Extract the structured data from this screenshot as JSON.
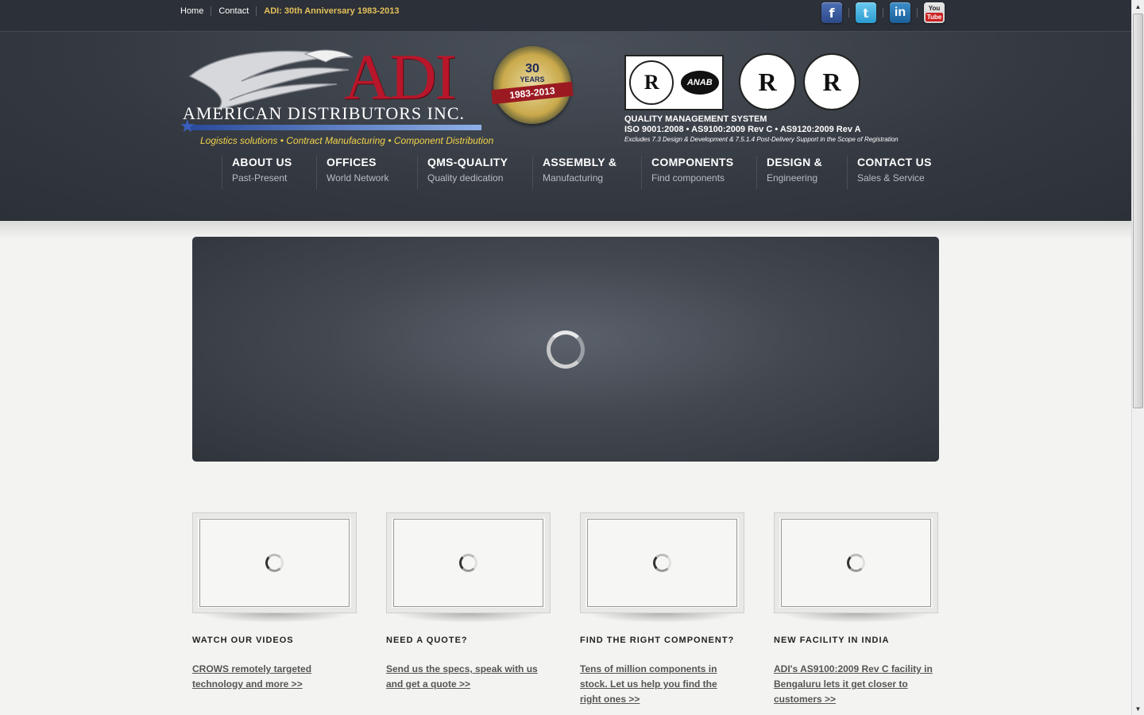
{
  "top_links": {
    "home": "Home",
    "contact": "Contact",
    "anniversary": "ADI: 30th Anniversary 1983-2013"
  },
  "social": {
    "facebook": "f",
    "twitter": "t",
    "linkedin": "in",
    "youtube_you": "You",
    "youtube_tube": "Tube"
  },
  "logo": {
    "wordmark": "ADI",
    "company": "AMERICAN DISTRIBUTORS INC.",
    "tagline": "Logistics solutions • Contract Manufacturing • Component Distribution"
  },
  "badge": {
    "number": "30",
    "label": "YEARS",
    "range": "1983-2013"
  },
  "certs": {
    "mark": "R",
    "anab": "ANAB",
    "qms_title": "QUALITY MANAGEMENT SYSTEM",
    "standards": "ISO 9001:2008 • AS9100:2009 Rev C • AS9120:2009 Rev A",
    "exclusions": "Excludes 7.3 Design & Development & 7.5.1.4 Post-Delivery Support in the Scope of Registration"
  },
  "nav": [
    {
      "title": "ABOUT US",
      "sub": "Past-Present"
    },
    {
      "title": "OFFICES",
      "sub": "World Network"
    },
    {
      "title": "QMS-QUALITY",
      "sub": "Quality dedication"
    },
    {
      "title": "ASSEMBLY &",
      "sub": "Manufacturing"
    },
    {
      "title": "COMPONENTS",
      "sub": "Find components"
    },
    {
      "title": "DESIGN &",
      "sub": "Engineering"
    },
    {
      "title": "CONTACT US",
      "sub": "Sales & Service"
    }
  ],
  "features": [
    {
      "title": "WATCH OUR VIDEOS",
      "link": "CROWS remotely targeted technology and more >>"
    },
    {
      "title": "NEED A QUOTE?",
      "link": "Send us the specs, speak with us and get a quote >>"
    },
    {
      "title": "FIND THE RIGHT COMPONENT?",
      "link": "Tens of million components in stock. Let us help you find the right ones >>"
    },
    {
      "title": "NEW FACILITY IN INDIA",
      "link": "ADI's AS9100:2009 Rev C facility in Bengaluru lets it get closer to customers >>"
    }
  ],
  "colors": {
    "accent_red": "#b8162a",
    "header_dark": "#2c3038",
    "tagline_yellow": "#f2d24a"
  }
}
